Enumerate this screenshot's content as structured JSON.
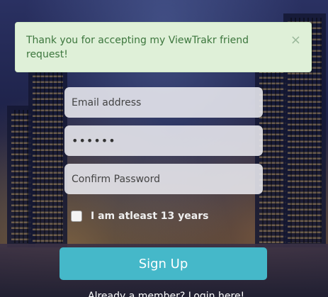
{
  "alert": {
    "message": "Thank you for accepting my ViewTrakr friend request!",
    "close_symbol": "×",
    "color": "#3c763d",
    "background": "#dff0d8"
  },
  "form": {
    "email_placeholder": "Email address",
    "password_value": "••••••",
    "confirm_placeholder": "Confirm Password",
    "age_label": "I am atleast 13 years",
    "signup_label": "Sign Up",
    "login_text": "Already a member? Login here!",
    "button_color": "#45b8c9"
  }
}
